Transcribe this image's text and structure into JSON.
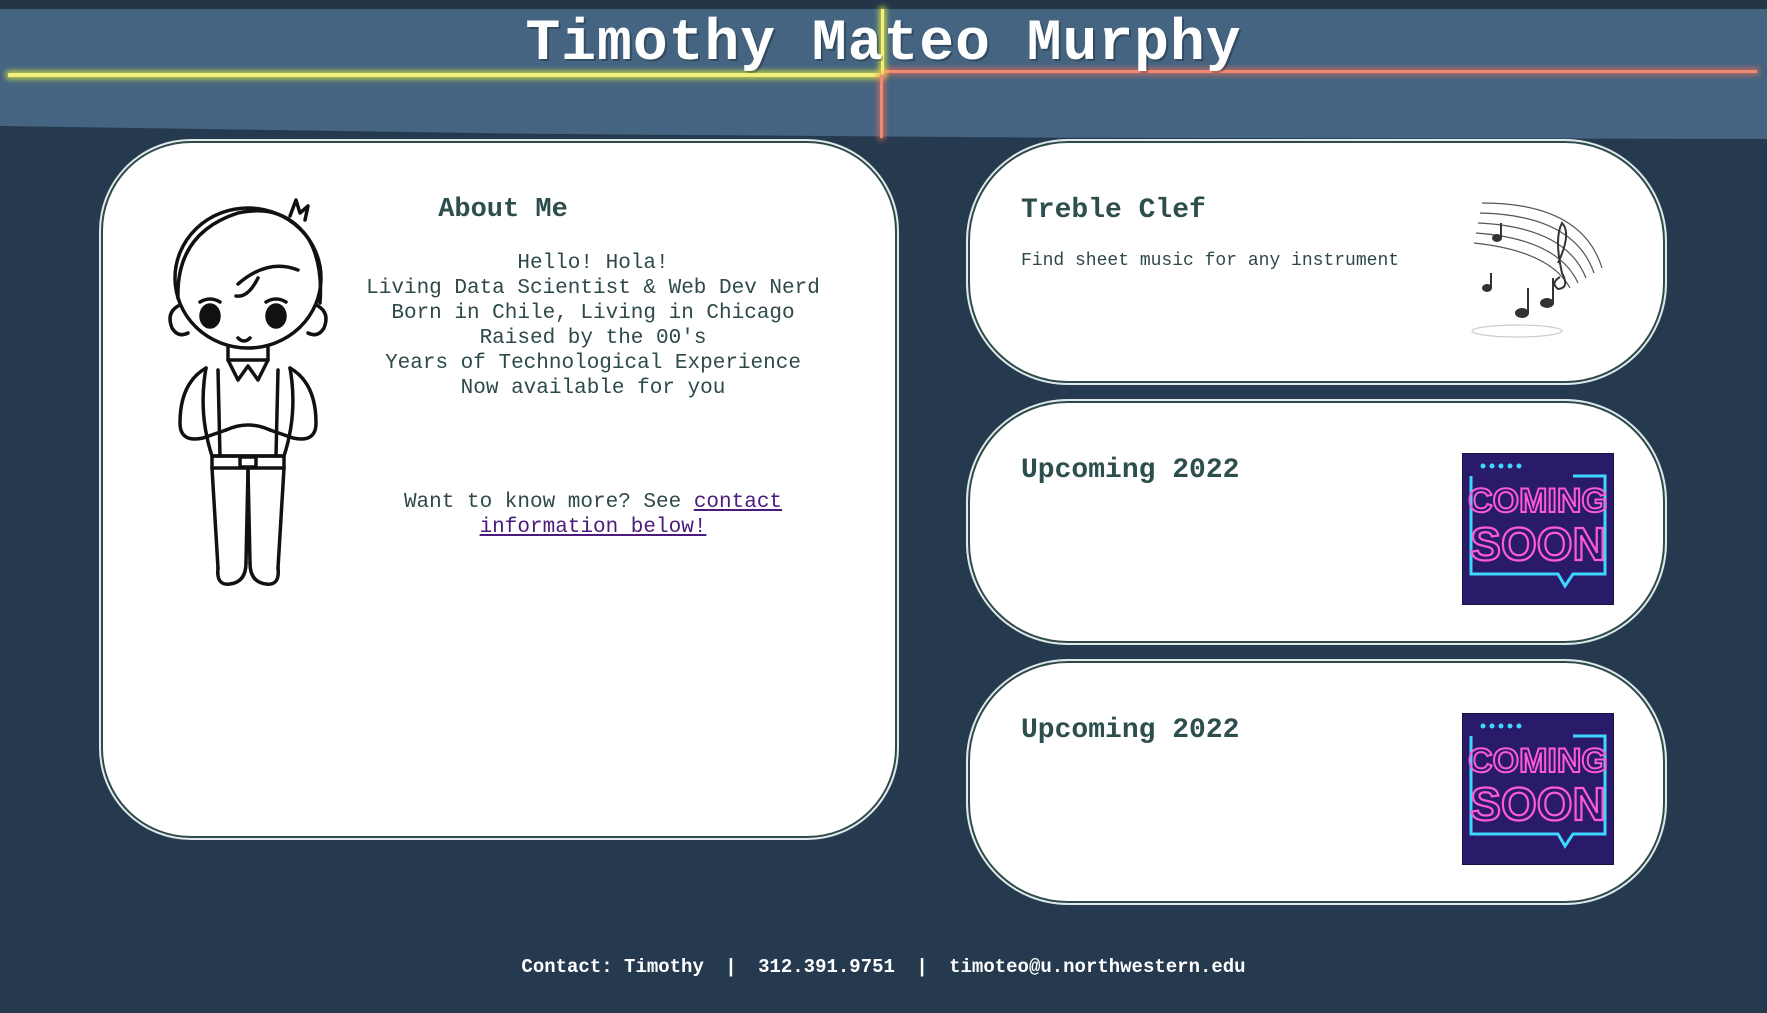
{
  "header": {
    "title": "Timothy Mateo Murphy"
  },
  "about": {
    "title": "About Me",
    "lines": [
      "Hello! Hola!",
      "Living Data Scientist & Web Dev Nerd",
      "Born in Chile, Living in Chicago",
      "Raised by the 00's",
      "Years of Technological Experience",
      "Now available for you"
    ],
    "more_prefix": "Want to know more? See ",
    "more_link": "contact information below!"
  },
  "cards": [
    {
      "title": "Treble Clef",
      "description": "Find sheet music for any instrument",
      "image_icon": "music-notes-icon"
    },
    {
      "title": "Upcoming 2022",
      "image_text": [
        "COMING",
        "SOON"
      ],
      "image_icon": "coming-soon-neon-icon"
    },
    {
      "title": "Upcoming 2022",
      "image_text": [
        "COMING",
        "SOON"
      ],
      "image_icon": "coming-soon-neon-icon"
    }
  ],
  "footer": {
    "contact": "Contact: Timothy",
    "phone": "312.391.9751",
    "email": "timoteo@u.northwestern.edu",
    "separator": "|"
  },
  "colors": {
    "background": "#253a4f",
    "header": "#446481",
    "card": "#ffffff",
    "heading_text": "#2e4e4e",
    "link": "#4b1a7a",
    "neon_pink": "#ff5ad6",
    "neon_blue": "#3fd6ff"
  }
}
